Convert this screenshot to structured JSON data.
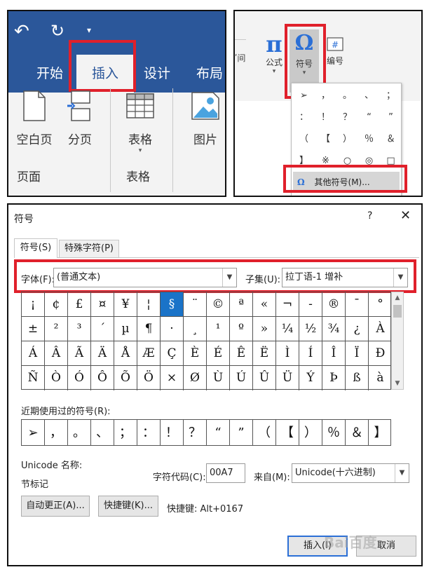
{
  "ribbon": {
    "tabs": [
      "开始",
      "插入",
      "设计",
      "布局"
    ],
    "buttons": {
      "blank_page": "空白页",
      "page_break": "分页",
      "table": "表格",
      "picture": "图片"
    },
    "groups": {
      "pages": "页面",
      "tables": "表格"
    },
    "colors": {
      "title_bar": "#2b579a",
      "highlight": "#e0202b"
    }
  },
  "symbol_menu": {
    "partial_label": "ʹ间",
    "buttons": {
      "formula": "公式",
      "symbol": "符号",
      "numbering": "编号"
    },
    "grid": [
      [
        "➢",
        "，",
        "。",
        "、",
        "；"
      ],
      [
        "：",
        "！",
        "？",
        "“",
        "”"
      ],
      [
        "（",
        "【",
        "）",
        "％",
        "＆"
      ],
      [
        "】",
        "※",
        "○",
        "◎",
        "□"
      ]
    ],
    "more_symbols": "其他符号(M)..."
  },
  "dialog": {
    "title": "符号",
    "help": "?",
    "close": "✕",
    "tab_symbols": "符号(S)",
    "tab_special": "特殊字符(P)",
    "font_label": "字体(F):",
    "font_value": "(普通文本)",
    "subset_label": "子集(U):",
    "subset_value": "拉丁语-1 增补",
    "symbols": [
      [
        "¡",
        "¢",
        "£",
        "¤",
        "¥",
        "¦",
        "§",
        "¨",
        "©",
        "ª",
        "«",
        "¬",
        "-",
        "®",
        "¯",
        "°"
      ],
      [
        "±",
        "²",
        "³",
        "´",
        "µ",
        "¶",
        "·",
        "¸",
        "¹",
        "º",
        "»",
        "¼",
        "½",
        "¾",
        "¿",
        "À"
      ],
      [
        "Á",
        "Â",
        "Ã",
        "Ä",
        "Å",
        "Æ",
        "Ç",
        "È",
        "É",
        "Ê",
        "Ë",
        "Ì",
        "Í",
        "Î",
        "Ï",
        "Ð"
      ],
      [
        "Ñ",
        "Ò",
        "Ó",
        "Ô",
        "Õ",
        "Ö",
        "×",
        "Ø",
        "Ù",
        "Ú",
        "Û",
        "Ü",
        "Ý",
        "Þ",
        "ß",
        "à"
      ]
    ],
    "selected_symbol": "§",
    "recent_label": "近期使用过的符号(R):",
    "recent": [
      "➢",
      "，",
      "。",
      "、",
      "；",
      "：",
      "！",
      "？",
      "“",
      "”",
      "（",
      "【",
      "）",
      "％",
      "＆",
      "】"
    ],
    "unicode_name_label": "Unicode 名称:",
    "unicode_name_value": "节标记",
    "char_code_label": "字符代码(C):",
    "char_code_value": "00A7",
    "from_label": "来自(M):",
    "from_value": "Unicode(十六进制)",
    "autocorrect_button": "自动更正(A)...",
    "shortcut_key_button": "快捷键(K)...",
    "shortcut_text": "快捷键: Alt+0167",
    "insert_button": "插入(I)",
    "cancel_button": "取消",
    "watermark": "Bai百度"
  }
}
